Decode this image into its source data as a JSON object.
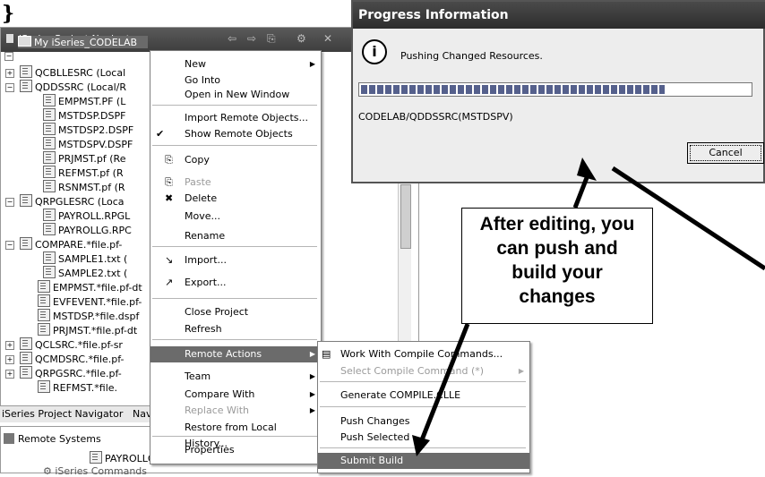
{
  "top_left_glyph": "}",
  "navigator": {
    "title": "iSeries Project Navigator",
    "toolbar_glyphs": [
      "⇦",
      "⇨",
      "⎘",
      "⚙",
      "✕"
    ],
    "root": "My iSeries_CODELAB",
    "items": [
      {
        "label": "QCBLLESRC (Local",
        "kind": "folder",
        "expander": "+"
      },
      {
        "label": "QDDSSRC (Local/R",
        "kind": "folder",
        "expander": "−"
      },
      {
        "label": "EMPMST.PF (L",
        "kind": "file"
      },
      {
        "label": "MSTDSP.DSPF",
        "kind": "file"
      },
      {
        "label": "MSTDSP2.DSPF",
        "kind": "file"
      },
      {
        "label": "MSTDSPV.DSPF",
        "kind": "file"
      },
      {
        "label": "PRJMST.pf (Re",
        "kind": "file"
      },
      {
        "label": "REFMST.pf (R",
        "kind": "file"
      },
      {
        "label": "RSNMST.pf (R",
        "kind": "file"
      },
      {
        "label": "QRPGLESRC (Loca",
        "kind": "folder",
        "expander": "−"
      },
      {
        "label": "PAYROLL.RPGL",
        "kind": "file"
      },
      {
        "label": "PAYROLLG.RPC",
        "kind": "file"
      },
      {
        "label": "COMPARE.*file.pf-",
        "kind": "folder",
        "expander": "−"
      },
      {
        "label": "SAMPLE1.txt (",
        "kind": "file"
      },
      {
        "label": "SAMPLE2.txt (",
        "kind": "file"
      },
      {
        "label": "EMPMST.*file.pf-dt",
        "kind": "file"
      },
      {
        "label": "EVFEVENT.*file.pf-",
        "kind": "file"
      },
      {
        "label": "MSTDSP.*file.dspf",
        "kind": "file"
      },
      {
        "label": "PRJMST.*file.pf-dt",
        "kind": "file"
      },
      {
        "label": "QCLSRC.*file.pf-sr",
        "kind": "folder",
        "expander": "+"
      },
      {
        "label": "QCMDSRC.*file.pf-",
        "kind": "folder",
        "expander": "+"
      },
      {
        "label": "QRPGSRC.*file.pf-",
        "kind": "folder",
        "expander": "+"
      },
      {
        "label": "REFMST.*file.",
        "kind": "file"
      }
    ],
    "tabs": [
      "iSeries Project Navigator",
      "Nav"
    ]
  },
  "remote_systems": {
    "title": "Remote Systems",
    "item1": "PAYROLLG.rpgle",
    "item2": "iSeries Commands"
  },
  "context_menu": {
    "items": [
      {
        "label": "New",
        "submenu": true
      },
      {
        "label": "Go Into"
      },
      {
        "label": "Open in New Window"
      },
      {
        "label": "Import Remote Objects..."
      },
      {
        "label": "Show Remote Objects",
        "checked": true
      },
      {
        "label": "Copy"
      },
      {
        "label": "Paste",
        "disabled": true
      },
      {
        "label": "Delete"
      },
      {
        "label": "Move..."
      },
      {
        "label": "Rename"
      },
      {
        "label": "Import..."
      },
      {
        "label": "Export..."
      },
      {
        "label": "Close Project"
      },
      {
        "label": "Refresh"
      },
      {
        "label": "Remote Actions",
        "submenu": true,
        "highlighted": true
      },
      {
        "label": "Team",
        "submenu": true
      },
      {
        "label": "Compare With",
        "submenu": true
      },
      {
        "label": "Replace With",
        "submenu": true,
        "disabled": true
      },
      {
        "label": "Restore from Local History..."
      },
      {
        "label": "Properties"
      }
    ]
  },
  "submenu": {
    "items": [
      {
        "label": "Work With Compile Commands..."
      },
      {
        "label": "Select Compile Command (*)",
        "disabled": true,
        "submenu": true
      },
      {
        "label": "Generate COMPILE.CLLE"
      },
      {
        "label": "Push Changes"
      },
      {
        "label": "Push Selected"
      },
      {
        "label": "Submit Build",
        "highlighted": true
      }
    ]
  },
  "progress_dialog": {
    "title": "Progress Information",
    "message": "Pushing Changed Resources.",
    "progress": 0.78,
    "detail": "CODELAB/QDDSSRC(MSTDSPV)",
    "cancel_label": "Cancel"
  },
  "callout": {
    "lines": [
      "After editing, you",
      "can push and",
      "build your",
      "changes"
    ]
  },
  "colors": {
    "highlight": "#6b6b6b",
    "title_bar": "#3d3d3d",
    "progress_fill": "#55608c"
  }
}
